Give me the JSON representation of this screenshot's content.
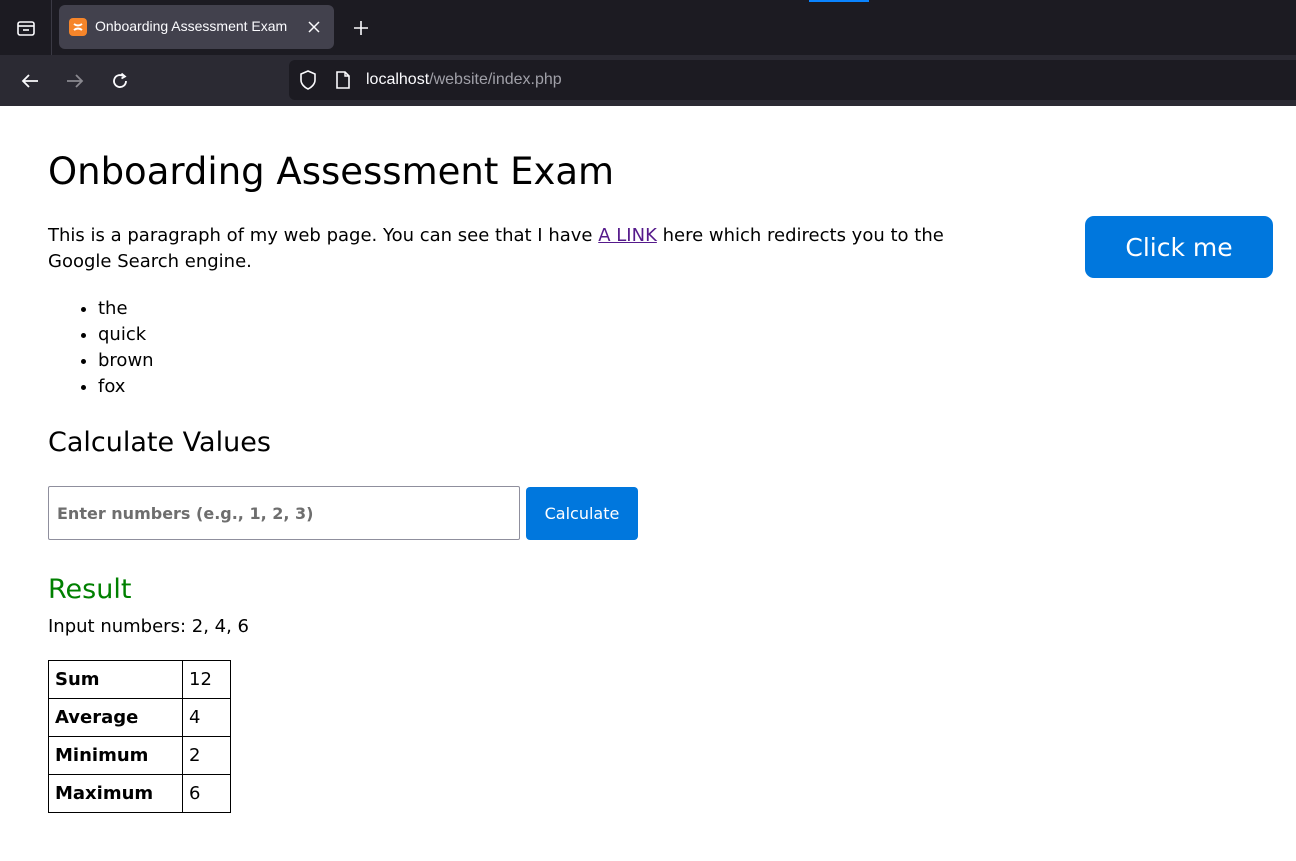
{
  "browser": {
    "tab_title": "Onboarding Assessment Exam",
    "url_host": "localhost",
    "url_path": "/website/index.php",
    "accent_color": "#0a84ff"
  },
  "page": {
    "heading": "Onboarding Assessment Exam",
    "paragraph_before": "This is a paragraph of my web page. You can see that I have ",
    "link_text": "A LINK",
    "paragraph_after": " here which redirects you to the Google Search engine.",
    "click_button": "Click me",
    "list_items": [
      "the",
      "quick",
      "brown",
      "fox"
    ],
    "calc_heading": "Calculate Values",
    "input_placeholder": "Enter numbers (e.g., 1, 2, 3)",
    "calc_button": "Calculate",
    "result_heading": "Result",
    "input_numbers_line": "Input numbers: 2, 4, 6",
    "stats": [
      {
        "label": "Sum",
        "value": "12"
      },
      {
        "label": "Average",
        "value": "4"
      },
      {
        "label": "Minimum",
        "value": "2"
      },
      {
        "label": "Maximum",
        "value": "6"
      }
    ],
    "button_color": "#0077dd",
    "result_color": "#008000"
  }
}
